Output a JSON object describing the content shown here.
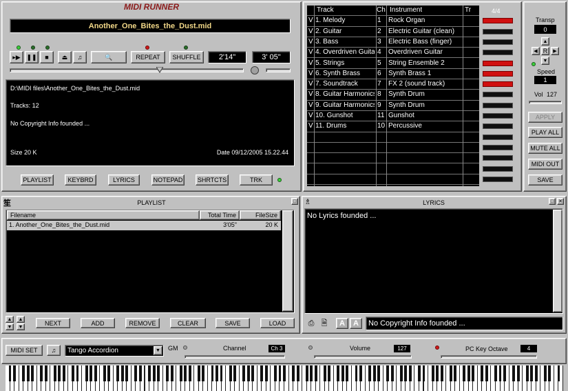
{
  "app": {
    "title": "MIDI RUNNER"
  },
  "player": {
    "song_name": "Another_One_Bites_the_Dust.mid",
    "time_elapsed": "2'14\"",
    "time_total": "3' 05\"",
    "repeat_label": "REPEAT",
    "shuffle_label": "SHUFFLE",
    "progress": 0.64,
    "info_path": "D:\\MIDI files\\Another_One_Bites_the_Dust.mid",
    "info_tracks": "Tracks: 12",
    "info_copyright": "No Copyright Info founded ...",
    "info_size": "Size 20 K",
    "info_date": "Date 09/12/2005 15.22.44"
  },
  "bottom_buttons": [
    "PLAYLIST",
    "KEYBRD",
    "LYRICS",
    "NOTEPAD",
    "SHRTCTS",
    "TRK"
  ],
  "tracks": {
    "headers": {
      "track": "Track",
      "ch": "Ch",
      "instrument": "Instrument",
      "tr": "Tr",
      "meter": "4/4"
    },
    "rows": [
      {
        "name": "1. Melody",
        "ch": "1",
        "instrument": "Rock Organ",
        "active": true
      },
      {
        "name": "2. Guitar",
        "ch": "2",
        "instrument": "Electric Guitar (clean)",
        "active": false
      },
      {
        "name": "3. Bass",
        "ch": "3",
        "instrument": "Electric Bass (finger)",
        "active": false
      },
      {
        "name": "4. Overdriven Guita",
        "ch": "4",
        "instrument": "Overdriven Guitar",
        "active": false
      },
      {
        "name": "5. Strings",
        "ch": "5",
        "instrument": "String Ensemble 2",
        "active": true
      },
      {
        "name": "6. Synth Brass",
        "ch": "6",
        "instrument": "Synth Brass 1",
        "active": true
      },
      {
        "name": "7. Soundtrack",
        "ch": "7",
        "instrument": "FX 2 (sound track)",
        "active": true
      },
      {
        "name": "8. Guitar Harmonics",
        "ch": "8",
        "instrument": "Synth Drum",
        "active": false
      },
      {
        "name": "9. Guitar Harmonics",
        "ch": "9",
        "instrument": "Synth Drum",
        "active": false
      },
      {
        "name": "10. Gunshot",
        "ch": "11",
        "instrument": "Gunshot",
        "active": false
      },
      {
        "name": "11. Drums",
        "ch": "10",
        "instrument": "Percussive",
        "active": false
      }
    ],
    "row_marker": "V"
  },
  "side": {
    "transp_label": "Transp",
    "transp_value": "0",
    "r_label": "R",
    "speed_label": "Speed",
    "speed_value": "1",
    "vol_label": "Vol",
    "vol_value": "127",
    "buttons": [
      "APPLY",
      "PLAY ALL",
      "MUTE ALL",
      "MIDI OUT",
      "SAVE"
    ]
  },
  "playlist": {
    "title": "PLAYLIST",
    "headers": {
      "filename": "Filename",
      "total_time": "Total Time",
      "filesize": "FileSize"
    },
    "items": [
      {
        "filename": "1. Another_One_Bites_the_Dust.mid",
        "total_time": "3'05\"",
        "filesize": "20 K"
      }
    ],
    "buttons": [
      "NEXT",
      "ADD",
      "REMOVE",
      "CLEAR",
      "SAVE",
      "LOAD"
    ]
  },
  "lyrics": {
    "title": "LYRICS",
    "text": "No Lyrics founded ...",
    "status": "No Copyright Info founded ...",
    "font_a1": "A",
    "font_a2": "A"
  },
  "keyboard_bar": {
    "midi_set_label": "MIDI SET",
    "instrument": "Tango Accordion",
    "gm_label": "GM",
    "channel_label": "Channel",
    "channel_value": "Ch 3",
    "volume_label": "Volume",
    "volume_value": "127",
    "octave_label": "PC Key Octave",
    "octave_value": "4"
  }
}
